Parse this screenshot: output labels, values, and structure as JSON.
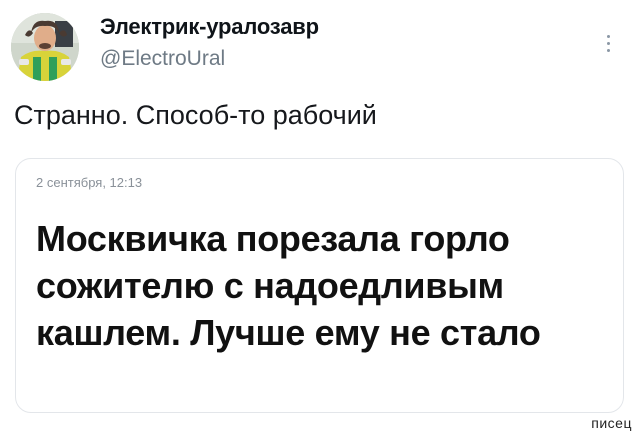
{
  "author": {
    "display_name": "Электрик-уралозавр",
    "handle": "@ElectroUral"
  },
  "tweet": {
    "text": "Странно. Способ-то рабочий"
  },
  "quoted_card": {
    "date": "2 сентября, 12:13",
    "headline": "Москвичка порезала горло сожителю с надоедливым кашлем. Лучше ему не стало"
  },
  "watermark": "писец",
  "icons": {
    "avatar": "user-avatar-photo",
    "more": "more-options-icon"
  },
  "colors": {
    "handle_gray": "#6e7a85",
    "text_dark": "#0f1419",
    "card_border": "#e3e6ea"
  }
}
